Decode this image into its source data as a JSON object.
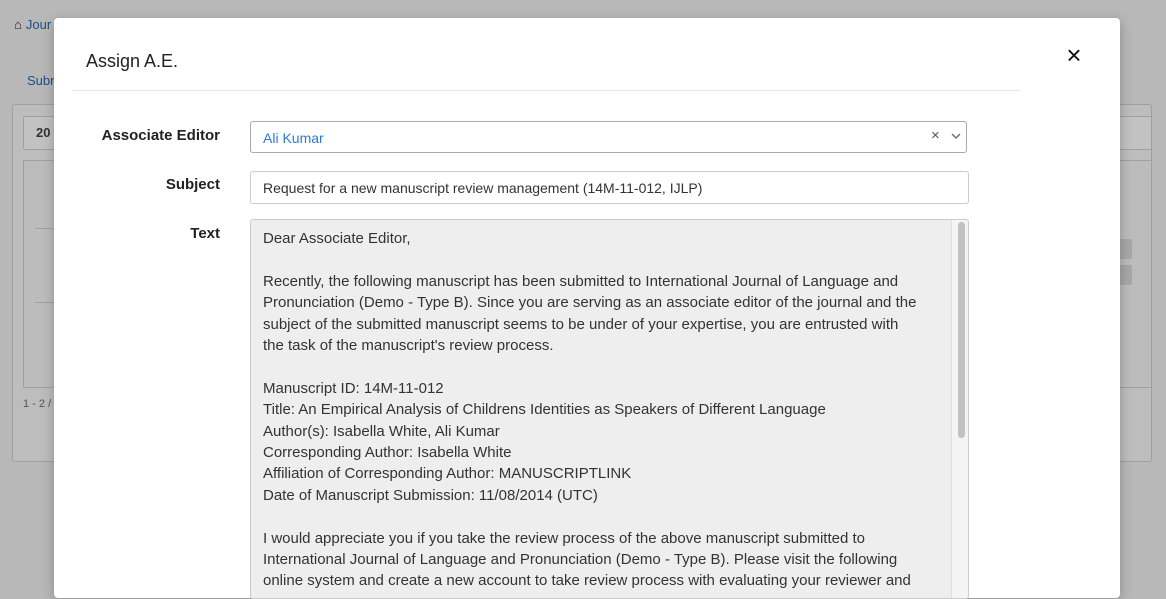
{
  "background": {
    "breadcrumb": "Jour",
    "tab": "Subr",
    "year_filter": "20",
    "pager": "1 - 2 /"
  },
  "modal": {
    "title": "Assign A.E.",
    "close_label": "×",
    "associate_editor_label": "Associate Editor",
    "associate_editor_value": "Ali Kumar",
    "clear_label": "×",
    "subject_label": "Subject",
    "subject_value": "Request for a new manuscript review management (14M-11-012, IJLP)",
    "text_label": "Text",
    "text_lines": [
      "Dear Associate Editor,",
      "",
      "Recently, the following manuscript has been submitted to International Journal of Language and",
      "Pronunciation (Demo - Type B). Since you are serving as an associate editor of the journal and the",
      "subject of the submitted manuscript seems to be under of your expertise, you are entrusted with",
      "the task of the manuscript's review process.",
      "",
      "Manuscript ID: 14M-11-012",
      "Title: An Empirical Analysis of Childrens Identities as Speakers of Different Language",
      "Author(s): Isabella White, Ali Kumar",
      "Corresponding Author: Isabella White",
      "Affiliation of Corresponding Author: MANUSCRIPTLINK",
      "Date of Manuscript Submission: 11/08/2014 (UTC)",
      "",
      "I would appreciate you if you take the review process of the above manuscript submitted to",
      "International Journal of Language and Pronunciation (Demo - Type B). Please visit the following",
      "online system and create a new account to take review process with evaluating your reviewer and"
    ]
  },
  "colors": {
    "accent": "#2a7ad8",
    "overlay": "#b8b8b8"
  }
}
